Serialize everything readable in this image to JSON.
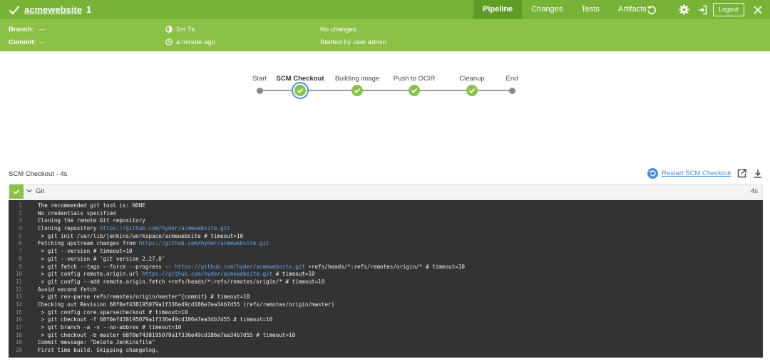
{
  "header": {
    "title": "acmewebsite",
    "run_number": "1",
    "tabs": [
      {
        "label": "Pipeline",
        "active": true
      },
      {
        "label": "Changes",
        "active": false
      },
      {
        "label": "Tests",
        "active": false
      },
      {
        "label": "Artifacts",
        "active": false
      }
    ],
    "logout_label": "Logout",
    "icons": [
      "replay-icon",
      "gear-icon",
      "exit-icon",
      "close-icon"
    ]
  },
  "info": {
    "branch_label": "Branch:",
    "branch_value": "—",
    "commit_label": "Commit:",
    "commit_value": "–",
    "duration": "1m 7s",
    "time_ago": "a minute ago",
    "changes": "No changes",
    "started_by": "Started by user admin"
  },
  "pipeline": {
    "stages": [
      "Start",
      "SCM Checkout",
      "Building image",
      "Push to OCIR",
      "Cleanup",
      "End"
    ],
    "selected": "SCM Checkout"
  },
  "step": {
    "header": "SCM Checkout - 4s",
    "restart_label": "Restart SCM Checkout",
    "name": "Git",
    "duration": "4s"
  },
  "log": [
    [
      "1",
      "The recommended git tool is: NONE"
    ],
    [
      "2",
      "No credentials specified"
    ],
    [
      "3",
      "Cloning the remote Git repository"
    ],
    [
      "4",
      "Cloning repository ",
      "https://github.com/hyder/acmewebsite.git",
      ""
    ],
    [
      "5",
      " > git init /var/lib/jenkins/workspace/acmewebsite # timeout=10"
    ],
    [
      "6",
      "Fetching upstream changes from ",
      "https://github.com/hyder/acmewebsite.git",
      ""
    ],
    [
      "7",
      " > git --version # timeout=10"
    ],
    [
      "8",
      " > git --version # 'git version 2.27.0'"
    ],
    [
      "9",
      " > git fetch --tags --force --progress -- ",
      "https://github.com/hyder/acmewebsite.git",
      " +refs/heads/*:refs/remotes/origin/* # timeout=10"
    ],
    [
      "10",
      " > git config remote.origin.url ",
      "https://github.com/hyder/acmewebsite.git",
      " # timeout=10"
    ],
    [
      "11",
      " > git config --add remote.origin.fetch +refs/heads/*:refs/remotes/origin/* # timeout=10"
    ],
    [
      "12",
      "Avoid second fetch"
    ],
    [
      "13",
      " > git rev-parse refs/remotes/origin/master^{commit} # timeout=10"
    ],
    [
      "14",
      "Checking out Revision 68f0ef438195079a1f336e49cd186e7ea34b7d55 (refs/remotes/origin/master)"
    ],
    [
      "15",
      " > git config core.sparsecheckout # timeout=10"
    ],
    [
      "16",
      " > git checkout -f 68f0ef438195079a1f336e49cd186e7ea34b7d55 # timeout=10"
    ],
    [
      "17",
      " > git branch -a -v --no-abbrev # timeout=10"
    ],
    [
      "18",
      " > git checkout -b master 68f0ef438195079a1f336e49cd186e7ea34b7d55 # timeout=10"
    ],
    [
      "19",
      "Commit message: \"Delete Jenkinsfile\""
    ],
    [
      "20",
      "First time build. Skipping changelog."
    ]
  ],
  "colors": {
    "topbar": "#76b336",
    "infobar": "#8dc046",
    "success": "#8cc04b",
    "link": "#4a90d9",
    "console_bg": "#333333"
  }
}
